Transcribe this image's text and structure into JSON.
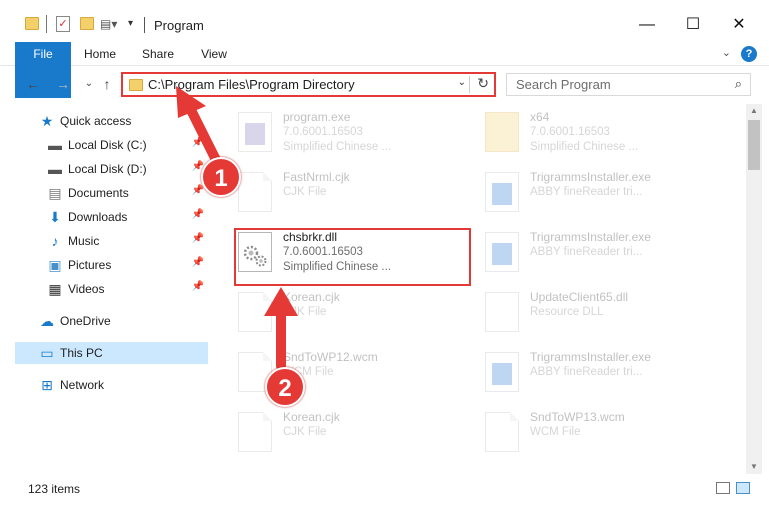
{
  "window": {
    "title": "Program",
    "minimize": "—",
    "maximize": "☐",
    "close": "✕"
  },
  "ribbon": {
    "tabs": [
      "File",
      "Home",
      "Share",
      "View"
    ],
    "help": "?"
  },
  "nav": {
    "address": "C:\\Program Files\\Program Directory",
    "search_placeholder": "Search Program"
  },
  "sidebar": {
    "items": [
      {
        "label": "Quick access",
        "icon": "star-icon"
      },
      {
        "label": "Local Disk (C:)",
        "icon": "drive-icon"
      },
      {
        "label": "Local Disk (D:)",
        "icon": "drive-icon"
      },
      {
        "label": "Documents",
        "icon": "documents-icon"
      },
      {
        "label": "Downloads",
        "icon": "download-icon"
      },
      {
        "label": "Music",
        "icon": "music-icon"
      },
      {
        "label": "Pictures",
        "icon": "pictures-icon"
      },
      {
        "label": "Videos",
        "icon": "videos-icon"
      },
      {
        "label": "OneDrive",
        "icon": "cloud-icon"
      },
      {
        "label": "This PC",
        "icon": "pc-icon"
      },
      {
        "label": "Network",
        "icon": "network-icon"
      }
    ]
  },
  "files": [
    {
      "name": "program.exe",
      "line2": "7.0.6001.16503",
      "line3": "Simplified Chinese ...",
      "icon": "exe-icon"
    },
    {
      "name": "x64",
      "line2": "7.0.6001.16503",
      "line3": "Simplified Chinese ...",
      "icon": "folder-icon"
    },
    {
      "name": "FastNrml.cjk",
      "line2": "CJK File",
      "line3": "",
      "icon": "document-icon"
    },
    {
      "name": "TrigrammsInstaller.exe",
      "line2": "ABBY fineReader tri...",
      "line3": "",
      "icon": "exe-icon"
    },
    {
      "name": "chsbrkr.dll",
      "line2": "7.0.6001.16503",
      "line3": "Simplified Chinese ...",
      "icon": "gear-file-icon"
    },
    {
      "name": "TrigrammsInstaller.exe",
      "line2": "ABBY fineReader tri...",
      "line3": "",
      "icon": "exe-icon"
    },
    {
      "name": "Korean.cjk",
      "line2": "CJK File",
      "line3": "",
      "icon": "document-icon"
    },
    {
      "name": "UpdateClient65.dll",
      "line2": "Resource DLL",
      "line3": "",
      "icon": "gear-file-icon"
    },
    {
      "name": "SndToWP12.wcm",
      "line2": "WCM File",
      "line3": "",
      "icon": "document-icon"
    },
    {
      "name": "TrigrammsInstaller.exe",
      "line2": "ABBY fineReader tri...",
      "line3": "",
      "icon": "exe-icon"
    },
    {
      "name": "Korean.cjk",
      "line2": "CJK File",
      "line3": "",
      "icon": "document-icon"
    },
    {
      "name": "SndToWP13.wcm",
      "line2": "WCM File",
      "line3": "",
      "icon": "document-icon"
    }
  ],
  "status": {
    "count": "123 items"
  },
  "annotations": {
    "step1": "1",
    "step2": "2",
    "color": "#e53935"
  }
}
